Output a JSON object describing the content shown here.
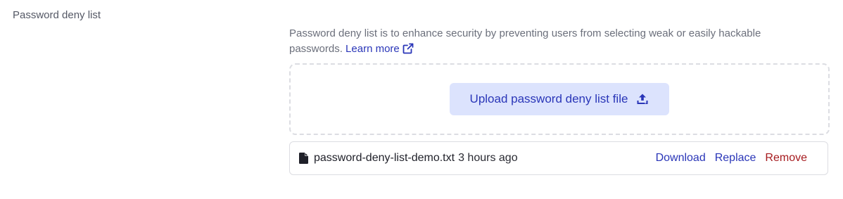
{
  "section": {
    "label": "Password deny list"
  },
  "description": {
    "text": "Password deny list is to enhance security by preventing users from selecting weak or easily hackable passwords.",
    "learn_more": "Learn more",
    "link_icon": "external-link-icon"
  },
  "upload": {
    "label": "Upload password deny list file",
    "icon": "upload-icon"
  },
  "file": {
    "icon": "file-icon",
    "name": "password-deny-list-demo.txt",
    "time": "3 hours ago",
    "actions": {
      "download": "Download",
      "replace": "Replace",
      "remove": "Remove"
    }
  },
  "colors": {
    "accent": "#2a36b8",
    "danger": "#a61b1f",
    "upload_bg": "#dce3fd"
  }
}
